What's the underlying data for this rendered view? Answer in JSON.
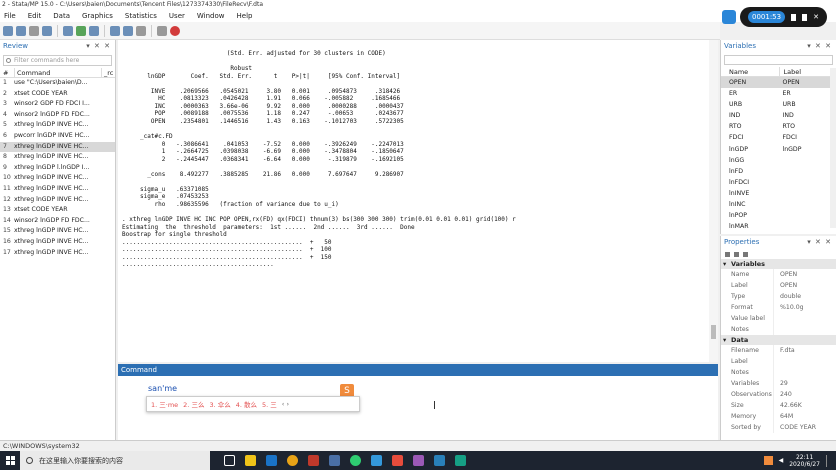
{
  "window": {
    "title": "2 - Stata/MP 15.0 - C:\\Users\\baien\\Documents\\Tencent Files\\1273374330\\FileRecv\\F.dta"
  },
  "menu": [
    "File",
    "Edit",
    "Data",
    "Graphics",
    "Statistics",
    "User",
    "Window",
    "Help"
  ],
  "recorder": {
    "time": "0001:53"
  },
  "review": {
    "title": "Review",
    "filter_placeholder": "Filter commands here",
    "col_num": "#",
    "col_command": "Command",
    "col_rc": "_rc",
    "rows": [
      {
        "n": "1",
        "cmd": "use \"C:\\Users\\baien\\D..."
      },
      {
        "n": "2",
        "cmd": "xtset CODE YEAR"
      },
      {
        "n": "3",
        "cmd": "winsor2 GDP FD FDCI I..."
      },
      {
        "n": "4",
        "cmd": "winsor2 lnGDP FD FDC..."
      },
      {
        "n": "5",
        "cmd": "xthreg lnGDP INVE HC..."
      },
      {
        "n": "6",
        "cmd": "pwcorr lnGDP INVE HC..."
      },
      {
        "n": "7",
        "cmd": "xthreg lnGDP INVE HC..."
      },
      {
        "n": "8",
        "cmd": "xthreg lnGDP INVE HC..."
      },
      {
        "n": "9",
        "cmd": "xthreg lnGDP l.lnGDP I..."
      },
      {
        "n": "10",
        "cmd": "xthreg lnGDP INVE HC..."
      },
      {
        "n": "11",
        "cmd": "xthreg lnGDP INVE HC..."
      },
      {
        "n": "12",
        "cmd": "xthreg lnGDP INVE HC..."
      },
      {
        "n": "13",
        "cmd": "xtset CODE YEAR"
      },
      {
        "n": "14",
        "cmd": "winsor2 lnGDP FD FDC..."
      },
      {
        "n": "15",
        "cmd": "xthreg lnGDP INVE HC..."
      },
      {
        "n": "16",
        "cmd": "xthreg lnGDP INVE HC..."
      },
      {
        "n": "17",
        "cmd": "xthreg lnGDP INVE HC..."
      }
    ],
    "selected_index": 6
  },
  "results": {
    "text": "                             (Std. Err. adjusted for 30 clusters in CODE)\n\n                              Robust\n       lnGDP       Coef.   Std. Err.      t    P>|t|     [95% Conf. Interval]\n\n        INVE    .2069566   .0545021     3.80   0.001     .0954873     .318426\n          HC    .0813323   .0426428     1.91   0.066    -.005882     .1685466\n         INC    .0000363   3.66e-06     9.92   0.000     .0000288     .0000437\n         POP    .0089188   .0075536     1.18   0.247     -.00653      .0243677\n        OPEN    .2354801   .1446516     1.43   0.163    -.1012703     .5722305\n\n     _cat#c.FD\n           0   -.3086641    .041053    -7.52   0.000    -.3926249    -.2247013\n           1   -.2664725   .0398038    -6.69   0.000    -.3478804    -.1850647\n           2   -.2445447   .0368341    -6.64   0.000     -.319879    -.1692105\n\n       _cons    8.492277   .3885285    21.86   0.000     7.697647     9.286907\n\n     sigma_u   .63371085\n     sigma_e   .07453253\n         rho   .98635596   (fraction of variance due to u_i)\n\n. xthreg lnGDP INVE HC INC POP OPEN,rx(FD) qx(FDCI) thnum(3) bs(300 300 300) trim(0.01 0.01 0.01) grid(100) r\nEstimating  the  threshold  parameters:  1st ......  2nd ......  3rd ......  Done\nBoostrap for single threshold\n..................................................  +   50\n..................................................  +  100\n..................................................  +  150\n.........................................."
  },
  "command": {
    "title": "Command",
    "ime_input": "san'me",
    "ime_candidates": [
      "1. 三·me",
      "2. 三么",
      "3. 伞么",
      "4. 散么",
      "5. 三"
    ],
    "ime_arrows": "‹ ›"
  },
  "variables": {
    "title": "Variables",
    "col_name": "Name",
    "col_label": "Label",
    "rows": [
      {
        "name": "OPEN",
        "label": "OPEN"
      },
      {
        "name": "ER",
        "label": "ER"
      },
      {
        "name": "URB",
        "label": "URB"
      },
      {
        "name": "IND",
        "label": "IND"
      },
      {
        "name": "RTO",
        "label": "RTO"
      },
      {
        "name": "FDCI",
        "label": "FDCI"
      },
      {
        "name": "lnGDP",
        "label": "lnGDP"
      },
      {
        "name": "lnGG",
        "label": ""
      },
      {
        "name": "lnFD",
        "label": ""
      },
      {
        "name": "lnFDCI",
        "label": ""
      },
      {
        "name": "lnINVE",
        "label": ""
      },
      {
        "name": "lnINC",
        "label": ""
      },
      {
        "name": "lnPOP",
        "label": ""
      },
      {
        "name": "lnMAR",
        "label": ""
      }
    ]
  },
  "properties": {
    "title": "Properties",
    "section_vars": "Variables",
    "var_props": [
      {
        "k": "Name",
        "v": "OPEN"
      },
      {
        "k": "Label",
        "v": "OPEN"
      },
      {
        "k": "Type",
        "v": "double"
      },
      {
        "k": "Format",
        "v": "%10.0g"
      },
      {
        "k": "Value label",
        "v": ""
      },
      {
        "k": "Notes",
        "v": ""
      }
    ],
    "section_data": "Data",
    "data_props": [
      {
        "k": "Filename",
        "v": "F.dta"
      },
      {
        "k": "Label",
        "v": ""
      },
      {
        "k": "Notes",
        "v": ""
      },
      {
        "k": "Variables",
        "v": "29"
      },
      {
        "k": "Observations",
        "v": "240"
      },
      {
        "k": "Size",
        "v": "42.66K"
      },
      {
        "k": "Memory",
        "v": "64M"
      },
      {
        "k": "Sorted by",
        "v": "CODE YEAR"
      }
    ]
  },
  "status": {
    "path": "C:\\WINDOWS\\system32"
  },
  "taskbar": {
    "search_placeholder": "在这里输入你要搜索的内容",
    "time": "22:11",
    "date": "2020/6/27"
  }
}
